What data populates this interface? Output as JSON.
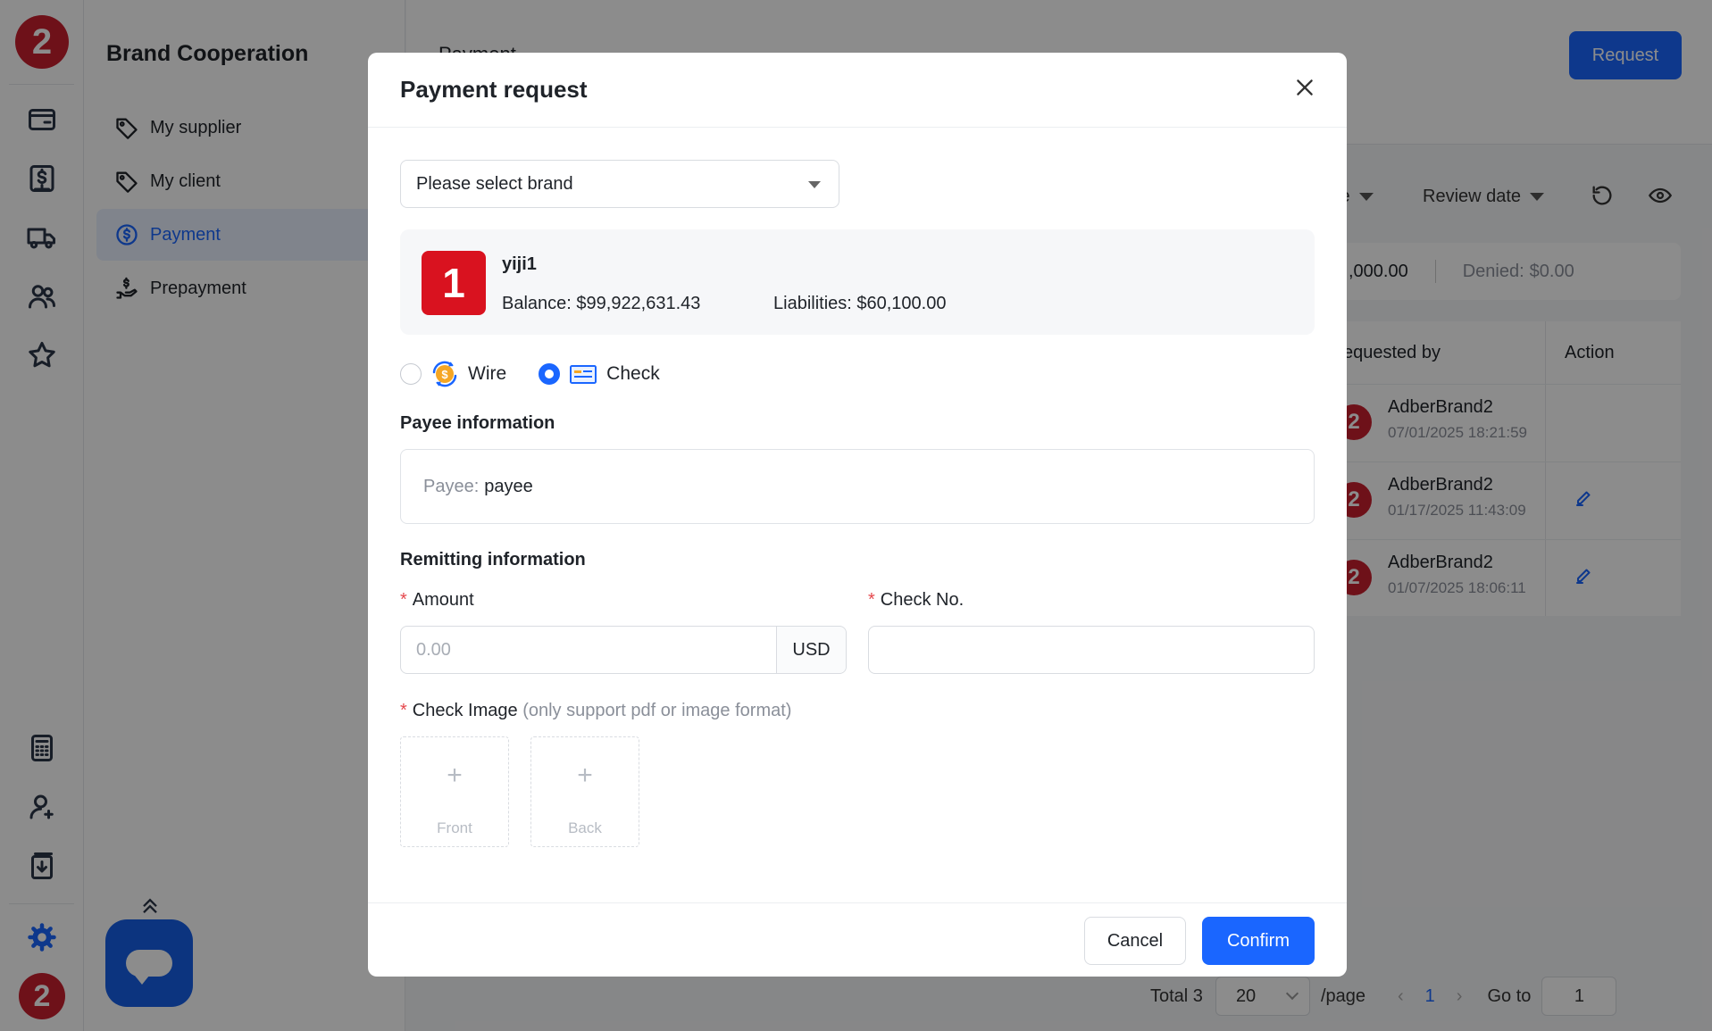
{
  "rail": {
    "logo_text": "2",
    "avatar_text": "2",
    "icons": [
      "wallet-icon",
      "dollar-bill-icon",
      "truck-icon",
      "users-icon",
      "star-icon",
      "calculator-icon",
      "user-icon",
      "download-list-icon",
      "gear-icon"
    ]
  },
  "sidebar": {
    "title": "Brand Cooperation",
    "items": [
      {
        "label": "My supplier",
        "icon": "tag-icon"
      },
      {
        "label": "My client",
        "icon": "tag-icon"
      },
      {
        "label": "Payment",
        "icon": "dollar-circle-icon",
        "active": true
      },
      {
        "label": "Prepayment",
        "icon": "hand-dollar-icon"
      }
    ]
  },
  "page": {
    "heading": "Payment",
    "request_button": "Request",
    "filters": {
      "date_partial": "te",
      "review_date": "Review date"
    },
    "summary": {
      "amount_partial": ",000.00",
      "denied_label": "Denied:",
      "denied_value": "$0.00"
    },
    "table": {
      "headers": {
        "requested_by": "equested by",
        "action": "Action"
      },
      "rows": [
        {
          "avatar": "2",
          "name": "AdberBrand2",
          "date": "07/01/2025 18:21:59",
          "editable": false
        },
        {
          "avatar": "2",
          "name": "AdberBrand2",
          "date": "01/17/2025 11:43:09",
          "editable": true
        },
        {
          "avatar": "2",
          "name": "AdberBrand2",
          "date": "01/07/2025 18:06:11",
          "editable": true
        }
      ]
    },
    "pager": {
      "total": "Total 3",
      "page_size": "20",
      "per_page": "/page",
      "current": "1",
      "goto_label": "Go to",
      "goto_value": "1"
    }
  },
  "modal": {
    "title": "Payment request",
    "brand_select_placeholder": "Please select brand",
    "brand": {
      "logo_text": "1",
      "name": "yiji1",
      "balance": "Balance: $99,922,631.43",
      "liabilities": "Liabilities: $60,100.00"
    },
    "methods": [
      {
        "label": "Wire",
        "selected": false,
        "icon": "wire-transfer-icon"
      },
      {
        "label": "Check",
        "selected": true,
        "icon": "check-card-icon"
      }
    ],
    "payee_section": "Payee information",
    "payee_key": "Payee:",
    "payee_value": "payee",
    "remit_section": "Remitting information",
    "amount_label": "Amount",
    "amount_placeholder": "0.00",
    "currency": "USD",
    "check_no_label": "Check No.",
    "check_image_label": "Check Image",
    "check_image_hint": "(only support pdf or image format)",
    "upload_front": "Front",
    "upload_back": "Back",
    "required_mark": "*",
    "cancel": "Cancel",
    "confirm": "Confirm"
  },
  "colors": {
    "accent": "#1a66ff",
    "brand_red": "#c8202f",
    "required": "#e5484d"
  }
}
